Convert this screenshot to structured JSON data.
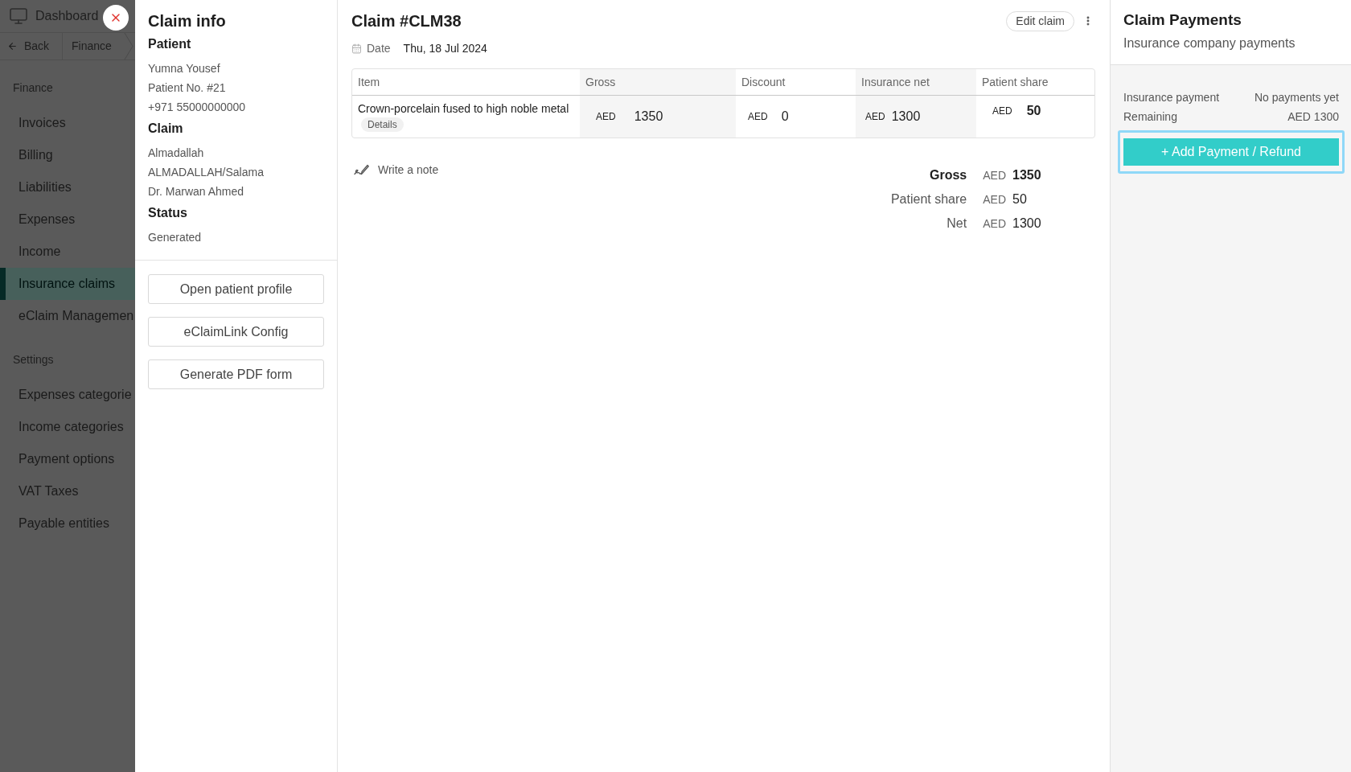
{
  "sidebar": {
    "title": "Dashboard",
    "breadcrumb": [
      {
        "kind": "back",
        "label": "Back"
      },
      {
        "kind": "crumb",
        "label": "Finance"
      }
    ],
    "sections": [
      {
        "title": "Finance",
        "items": [
          {
            "label": "Invoices",
            "selected": false
          },
          {
            "label": "Billing",
            "selected": false
          },
          {
            "label": "Liabilities",
            "selected": false
          },
          {
            "label": "Expenses",
            "selected": false
          },
          {
            "label": "Income",
            "selected": false
          },
          {
            "label": "Insurance claims",
            "selected": true
          },
          {
            "label": "eClaim Managemen",
            "selected": false
          }
        ]
      },
      {
        "title": "Settings",
        "items": [
          {
            "label": "Expenses categorie",
            "selected": false
          },
          {
            "label": "Income categories",
            "selected": false
          },
          {
            "label": "Payment options",
            "selected": false
          },
          {
            "label": "VAT Taxes",
            "selected": false
          },
          {
            "label": "Payable entities",
            "selected": false
          }
        ]
      }
    ]
  },
  "claim_info": {
    "title": "Claim info",
    "groups": [
      {
        "heading": "Patient",
        "lines": [
          "Yumna Yousef",
          "Patient No. #21",
          "+971 55000000000"
        ]
      },
      {
        "heading": "Claim",
        "lines": [
          "Almadallah",
          "ALMADALLAH/Salama",
          "Dr. Marwan Ahmed"
        ]
      },
      {
        "heading": "Status",
        "lines": [
          "Generated"
        ]
      }
    ],
    "buttons": [
      "Open patient profile",
      "eClaimLink Config",
      "Generate PDF form"
    ]
  },
  "claim": {
    "title": "Claim #CLM38",
    "edit_button": "Edit claim",
    "date": {
      "label": "Date",
      "value": "Thu, 18 Jul 2024"
    },
    "table": {
      "columns": [
        "Item",
        "Gross",
        "Discount",
        "Insurance net",
        "Patient share"
      ],
      "rows": [
        {
          "item": "Crown-porcelain fused to high noble metal",
          "details": "Details",
          "amounts": [
            {
              "currency": "AED",
              "amount": "1350",
              "emphasized": false
            },
            {
              "currency": "AED",
              "amount": "0",
              "emphasized": false
            },
            {
              "currency": "AED",
              "amount": "1300",
              "emphasized": false
            },
            {
              "currency": "AED",
              "amount": "50",
              "emphasized": true
            }
          ]
        }
      ]
    },
    "note_link": "Write a note",
    "summary": [
      {
        "label": "Gross",
        "currency": "AED",
        "amount": "1350",
        "emphasized": true
      },
      {
        "label": "Patient share",
        "currency": "AED",
        "amount": "50",
        "emphasized": false
      },
      {
        "label": "Net",
        "currency": "AED",
        "amount": "1300",
        "emphasized": false
      }
    ]
  },
  "payments": {
    "title": "Claim Payments",
    "subtitle": "Insurance company payments",
    "rows": [
      {
        "label": "Insurance payment",
        "value": "No payments yet"
      },
      {
        "label": "Remaining",
        "value": "AED 1300"
      }
    ],
    "add_button": {
      "label": "+ Add Payment / Refund",
      "focused": true
    }
  }
}
